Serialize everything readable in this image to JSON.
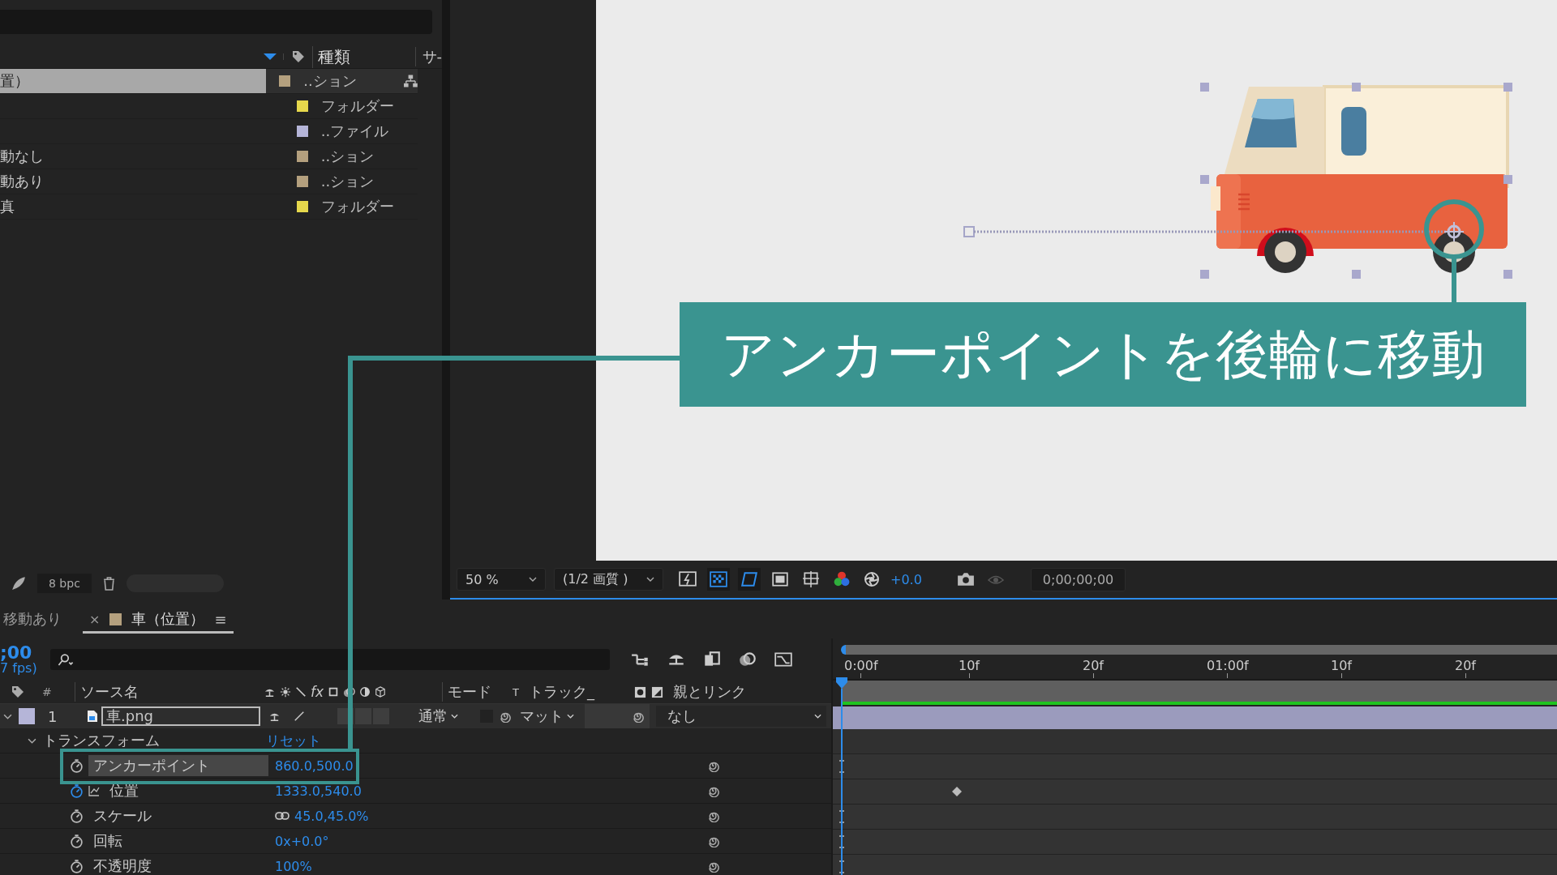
{
  "project": {
    "columns": [
      {
        "label": "種類"
      },
      {
        "label": "サ-"
      }
    ],
    "items": [
      {
        "name": "置）",
        "type": "..ション",
        "color": "#b4a07e",
        "selected": true
      },
      {
        "type": "フォルダー",
        "color": "#e6d84c",
        "selected": false
      },
      {
        "type": "..ファイル",
        "color": "#b5b5d8",
        "selected": false
      },
      {
        "name": "動なし",
        "type": "..ション",
        "color": "#b4a07e",
        "selected": false
      },
      {
        "name": "動あり",
        "type": "..ション",
        "color": "#b4a07e",
        "selected": false
      },
      {
        "name": "真",
        "type": "フォルダー",
        "color": "#e6d84c",
        "selected": false
      }
    ],
    "bit_depth": "8 bpc"
  },
  "viewer": {
    "zoom": "50 %",
    "resolution": "(1/2 画質 )",
    "exposure": "+0.0",
    "timecode": "0;00;00;00"
  },
  "callout": {
    "text": "アンカーポイントを後輪に移動"
  },
  "timeline": {
    "tabs": [
      {
        "label": "移動あり",
        "selected": false
      },
      {
        "label": "車（位置）",
        "color": "#b4a07e",
        "selected": true,
        "close": "×",
        "menu": "≡"
      }
    ],
    "current_time": ";00",
    "fps": "7 fps)",
    "columns": {
      "number": "#",
      "source": "ソース名",
      "fx": "fx",
      "mode": "モード",
      "t": "T",
      "track": "トラック_",
      "parent": "親とリンク"
    },
    "ruler": [
      "0:00f",
      "10f",
      "20f",
      "01:00f",
      "10f",
      "20f"
    ],
    "layers": [
      {
        "number": "1",
        "name": "車.png",
        "color": "#b5b5d8",
        "expanded": true,
        "mode": "通常",
        "preserve_transparency": false,
        "matte": "マット",
        "parent": "なし",
        "children": [
          {
            "label": "トランスフォーム",
            "expanded": true,
            "action": "リセット",
            "children": [
              {
                "label": "アンカーポイント",
                "value": "860.0,500.0",
                "animated": false,
                "selected": true,
                "keyframe": false
              },
              {
                "label": "位置",
                "value": "1333.0,540.0",
                "animated": true,
                "selected": false,
                "keyframe": true
              },
              {
                "label": "スケール",
                "value": "45.0,45.0%",
                "linked": true,
                "animated": false,
                "selected": false,
                "keyframe": false
              },
              {
                "label": "回転",
                "value": "0x+0.0°",
                "animated": false,
                "selected": false,
                "keyframe": false
              },
              {
                "label": "不透明度",
                "value": "100%",
                "animated": false,
                "selected": false,
                "keyframe": false
              }
            ]
          }
        ]
      }
    ]
  }
}
